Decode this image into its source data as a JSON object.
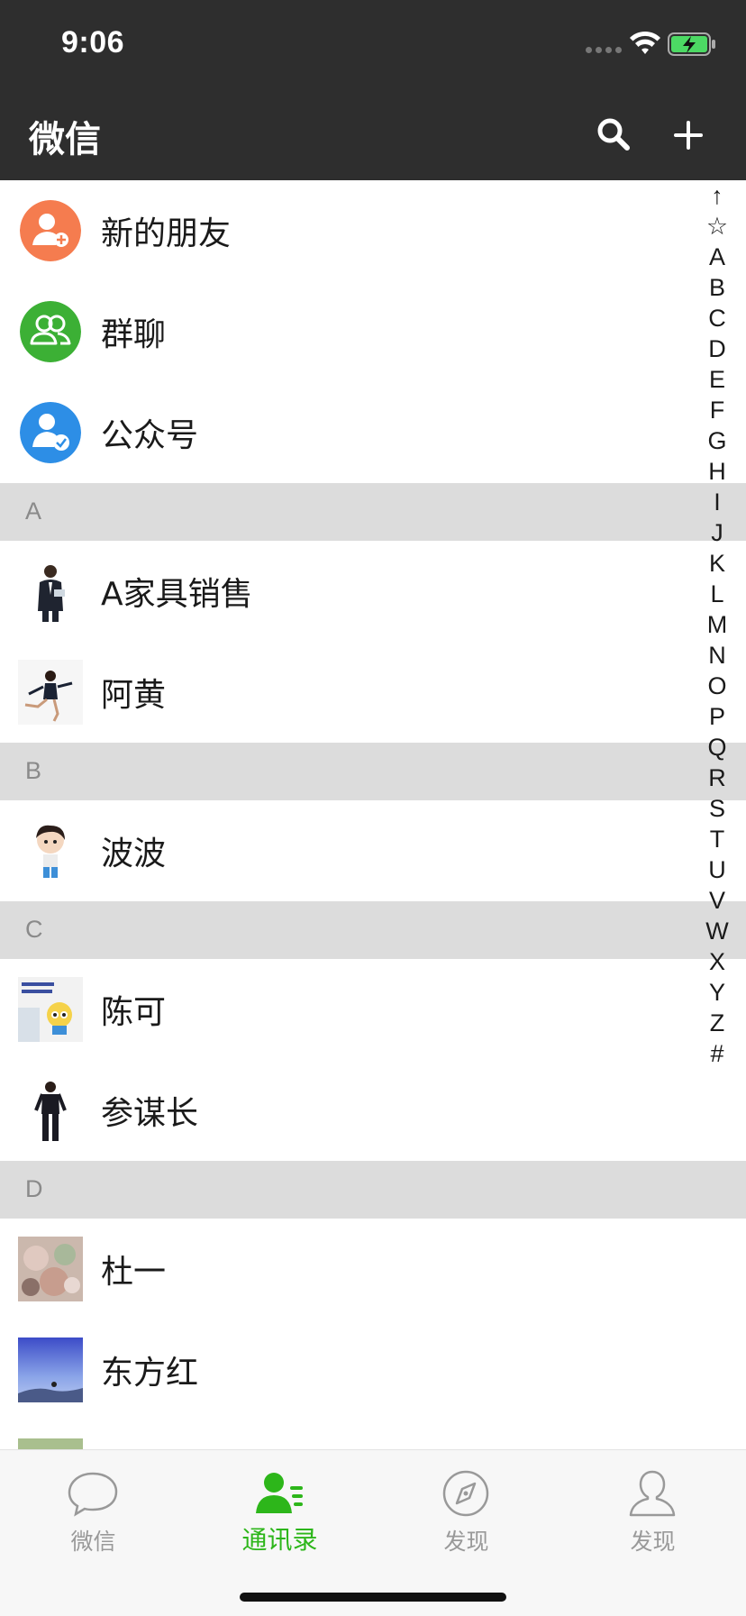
{
  "status_bar": {
    "time": "9:06"
  },
  "nav": {
    "title": "微信"
  },
  "top_entries": [
    {
      "label": "新的朋友",
      "icon": "add-friend-icon",
      "color": "#f57c4f"
    },
    {
      "label": "群聊",
      "icon": "group-chat-icon",
      "color": "#3cb035"
    },
    {
      "label": "公众号",
      "icon": "official-account-icon",
      "color": "#2d8ee6"
    }
  ],
  "sections": [
    {
      "letter": "A",
      "contacts": [
        "A家具销售",
        "阿黄"
      ]
    },
    {
      "letter": "B",
      "contacts": [
        "波波"
      ]
    },
    {
      "letter": "C",
      "contacts": [
        "陈可",
        "参谋长"
      ]
    },
    {
      "letter": "D",
      "contacts": [
        "杜一",
        "东方红"
      ]
    }
  ],
  "index": [
    "↑",
    "☆",
    "A",
    "B",
    "C",
    "D",
    "E",
    "F",
    "G",
    "H",
    "I",
    "J",
    "K",
    "L",
    "M",
    "N",
    "O",
    "P",
    "Q",
    "R",
    "S",
    "T",
    "U",
    "V",
    "W",
    "X",
    "Y",
    "Z",
    "#"
  ],
  "tabs": [
    {
      "label": "微信",
      "icon": "chat-bubble-icon",
      "active": false
    },
    {
      "label": "通讯录",
      "icon": "contacts-icon",
      "active": true
    },
    {
      "label": "发现",
      "icon": "compass-icon",
      "active": false
    },
    {
      "label": "发现",
      "icon": "profile-icon",
      "active": false
    }
  ],
  "colors": {
    "bar_dark": "#2e2e2e",
    "accent_green": "#2db61a",
    "section_bg": "#dcdcdc"
  }
}
